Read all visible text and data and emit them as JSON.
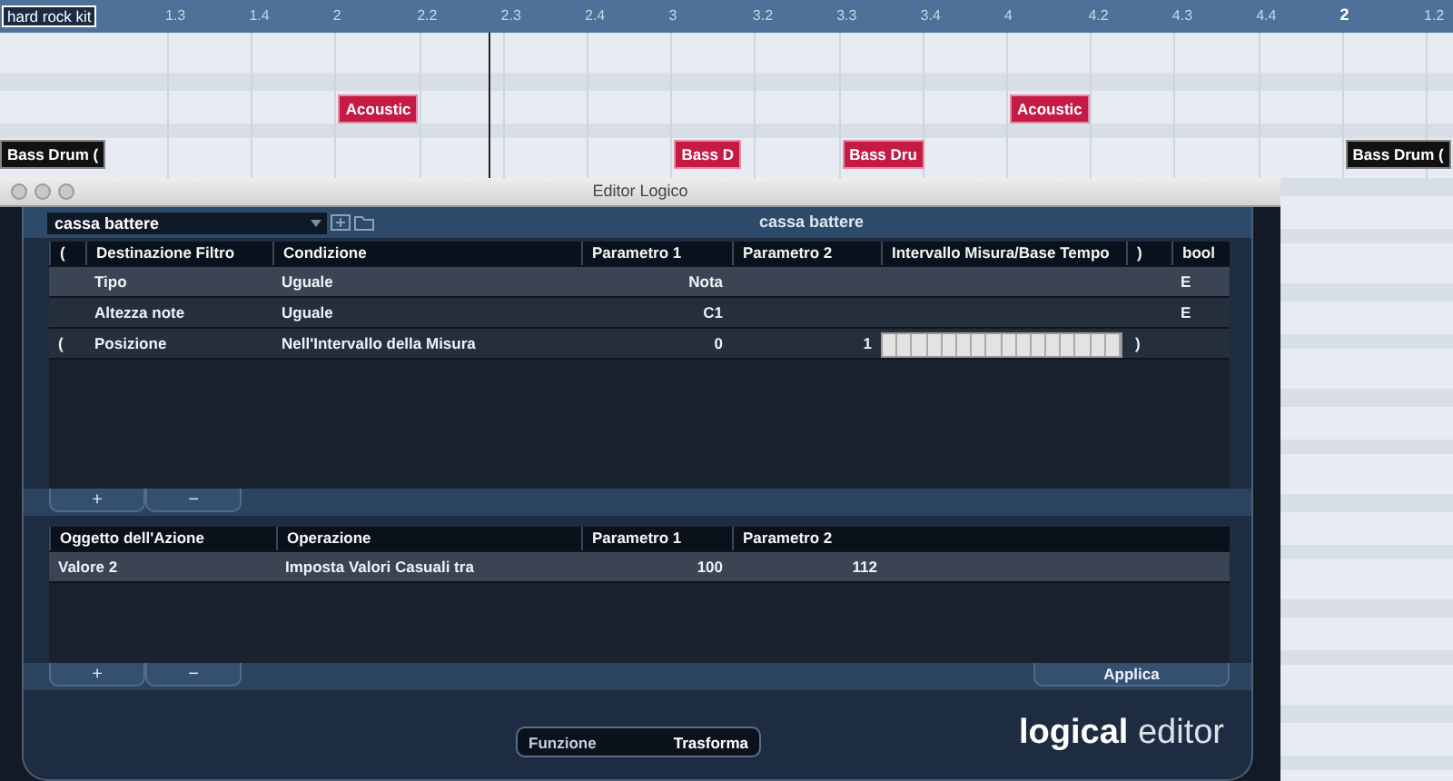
{
  "ruler": {
    "track_label": "hard rock kit",
    "ticks": [
      {
        "label": "1.3",
        "bar_start": false
      },
      {
        "label": "1.4",
        "bar_start": false
      },
      {
        "label": "2",
        "bar_start": false
      },
      {
        "label": "2.2",
        "bar_start": false
      },
      {
        "label": "2.3",
        "bar_start": false
      },
      {
        "label": "2.4",
        "bar_start": false
      },
      {
        "label": "3",
        "bar_start": false
      },
      {
        "label": "3.2",
        "bar_start": false
      },
      {
        "label": "3.3",
        "bar_start": false
      },
      {
        "label": "3.4",
        "bar_start": false
      },
      {
        "label": "4",
        "bar_start": false
      },
      {
        "label": "4.2",
        "bar_start": false
      },
      {
        "label": "4.3",
        "bar_start": false
      },
      {
        "label": "4.4",
        "bar_start": false
      },
      {
        "label": "2",
        "bar_start": true
      },
      {
        "label": "1.2",
        "bar_start": false
      }
    ]
  },
  "parts": [
    {
      "label": "Acoustic",
      "color": "#c41a44"
    },
    {
      "label": "Acoustic",
      "color": "#c41a44"
    },
    {
      "label": "Bass Drum (",
      "color": "#111111"
    },
    {
      "label": "Bass D",
      "color": "#c41a44"
    },
    {
      "label": "Bass Dru",
      "color": "#c41a44"
    },
    {
      "label": "Bass Drum (",
      "color": "#111111"
    }
  ],
  "window": {
    "title": "Editor Logico",
    "preset": {
      "value": "cassa battere"
    },
    "preset_title": "cassa battere",
    "filter_table": {
      "columns": [
        "(",
        "Destinazione Filtro",
        "Condizione",
        "Parametro 1",
        "Parametro 2",
        "Intervallo Misura/Base Tempo",
        ")",
        "bool"
      ],
      "rows": [
        {
          "selected": true,
          "cells": [
            "",
            "Tipo",
            "Uguale",
            "Nota",
            "",
            "",
            "",
            "E"
          ],
          "bar_range": false
        },
        {
          "selected": false,
          "cells": [
            "",
            "Altezza note",
            "Uguale",
            "C1",
            "",
            "",
            "",
            "E"
          ],
          "bar_range": false
        },
        {
          "selected": false,
          "cells": [
            "(",
            "Posizione",
            "Nell'Intervallo della Misura",
            "0",
            "1",
            "",
            ")",
            ""
          ],
          "bar_range": true
        }
      ]
    },
    "filter_buttons": [
      "+",
      "−"
    ],
    "action_table": {
      "columns": [
        "Oggetto dell'Azione",
        "Operazione",
        "Parametro 1",
        "Parametro 2"
      ],
      "rows": [
        {
          "selected": true,
          "cells": [
            "Valore 2",
            "Imposta Valori Casuali tra",
            "100",
            "112"
          ]
        }
      ]
    },
    "action_buttons": [
      "+",
      "−"
    ],
    "apply_button": "Applica",
    "function": {
      "label": "Funzione",
      "value": "Trasforma"
    },
    "logo": {
      "bold": "logical",
      "light": "editor"
    }
  }
}
